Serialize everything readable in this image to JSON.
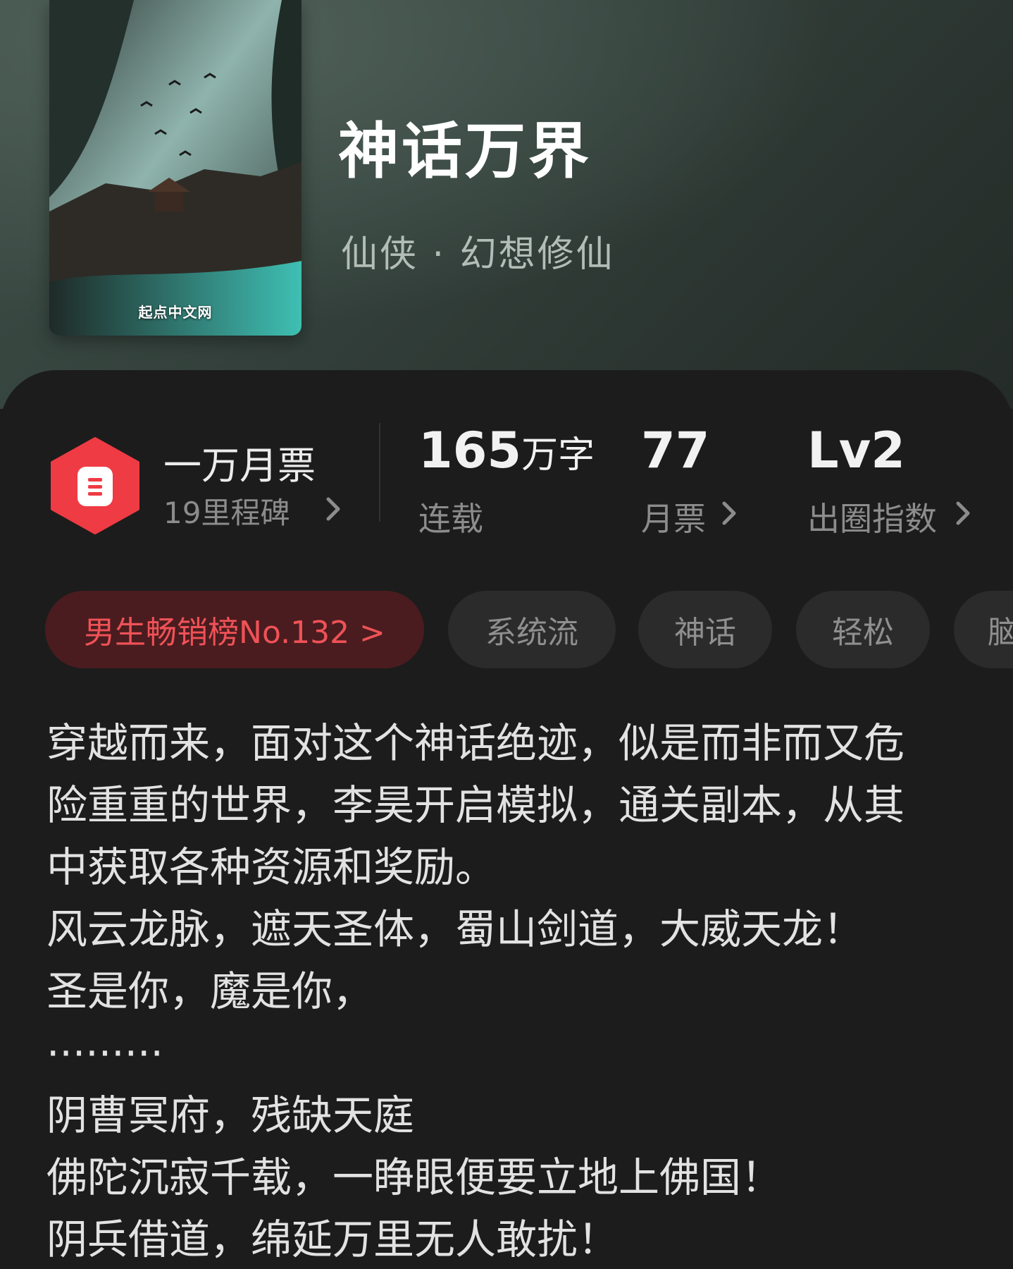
{
  "book": {
    "title": "神话万界",
    "genre": "仙侠 · 幻想修仙",
    "cover_logo": "起点中文网"
  },
  "milestone": {
    "icon": "ticket-icon",
    "badge_color": "#ef3b43",
    "title": "一万月票",
    "subtitle": "19里程碑"
  },
  "stats": [
    {
      "value": "165",
      "unit": "万字",
      "label": "连载"
    },
    {
      "value": "77",
      "unit": "",
      "label": "月票"
    },
    {
      "value": "Lv2",
      "unit": "",
      "label": "出圈指数"
    }
  ],
  "tags": {
    "rank": "男生畅销榜No.132 >",
    "items": [
      "系统流",
      "神话",
      "轻松",
      "脑"
    ]
  },
  "description": "穿越而来，面对这个神话绝迹，似是而非而又危\n险重重的世界，李昊开启模拟，通关副本，从其\n中获取各种资源和奖励。\n风云龙脉，遮天圣体，蜀山剑道，大威天龙！\n圣是你，魔是你，\n·········\n阴曹冥府，残缺天庭\n佛陀沉寂千载，一睁眼便要立地上佛国！\n阴兵借道，绵延万里无人敢扰！",
  "colors": {
    "header_bg": "#3a4842",
    "card_bg": "#1c1c1c",
    "accent_red": "#ef5257",
    "rank_tag_bg": "#4a1c1f",
    "tag_bg": "#2b2b2b"
  }
}
